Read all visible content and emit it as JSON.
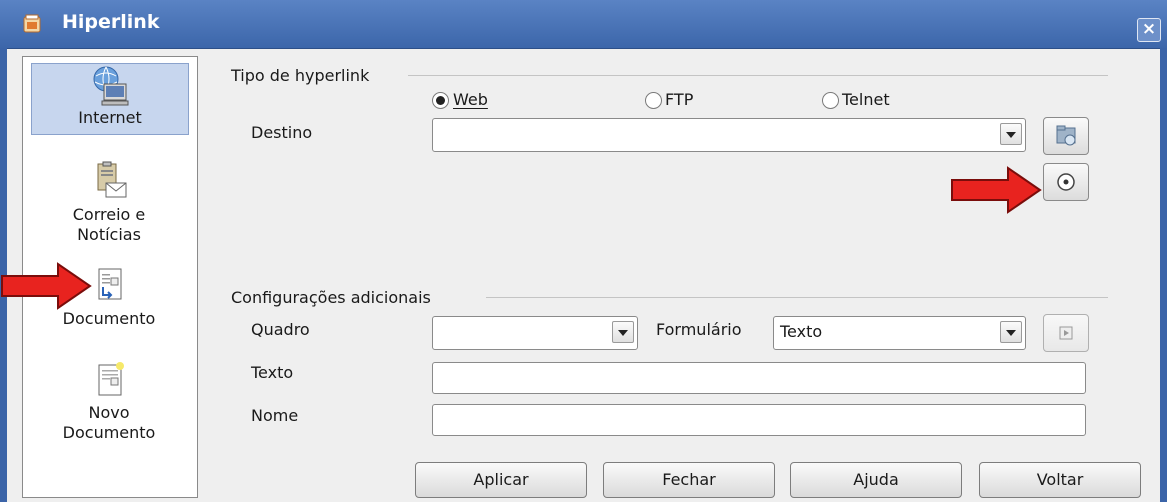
{
  "window": {
    "title": "Hiperlink",
    "close_glyph": "×"
  },
  "sidebar": {
    "items": [
      {
        "label": "Internet",
        "icon": "internet-globe-icon",
        "selected": true
      },
      {
        "label_line1": "Correio e",
        "label_line2": "Notícias",
        "icon": "mail-news-icon"
      },
      {
        "label": "Documento",
        "icon": "document-icon"
      },
      {
        "label_line1": "Novo",
        "label_line2": "Documento",
        "icon": "new-document-icon"
      }
    ]
  },
  "hyperlink_type": {
    "title": "Tipo de hyperlink",
    "options": [
      {
        "label": "Web",
        "selected": true
      },
      {
        "label": "FTP",
        "selected": false
      },
      {
        "label": "Telnet",
        "selected": false
      }
    ]
  },
  "destino": {
    "label": "Destino",
    "value": ""
  },
  "additional": {
    "title": "Configurações adicionais",
    "quadro": {
      "label": "Quadro",
      "value": ""
    },
    "formulario": {
      "label": "Formulário",
      "value": "Texto"
    },
    "texto": {
      "label": "Texto",
      "value": ""
    },
    "nome": {
      "label": "Nome",
      "value": ""
    }
  },
  "buttons": {
    "apply": "Aplicar",
    "close": "Fechar",
    "help": "Ajuda",
    "back": "Voltar"
  },
  "colors": {
    "titlebar": "#3c66aa",
    "selection": "#c7d6ee",
    "annotation_arrow": "#e8231f"
  }
}
